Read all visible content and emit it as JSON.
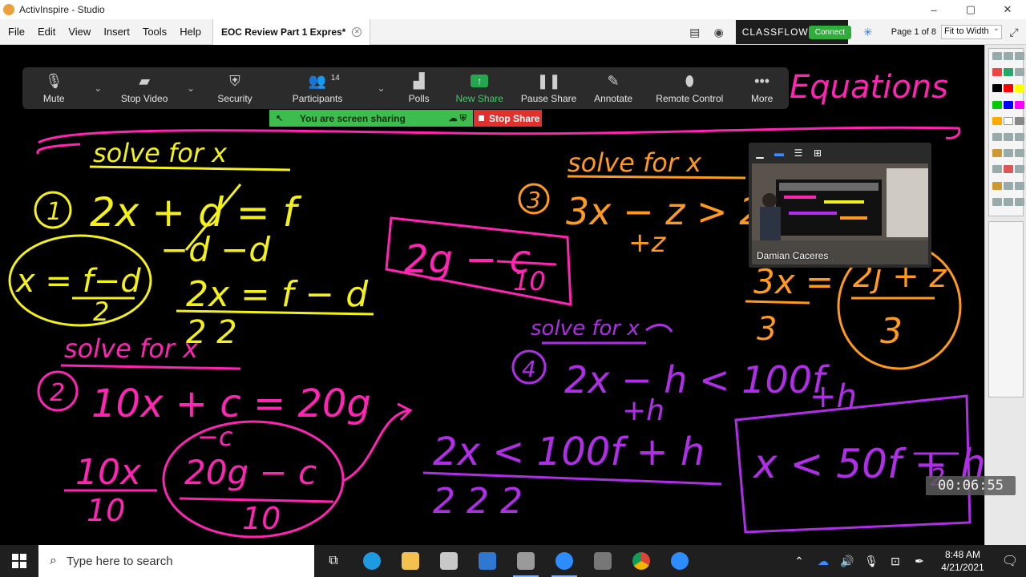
{
  "window": {
    "title": "ActivInspire - Studio",
    "controls": [
      "–",
      "▢",
      "✕"
    ]
  },
  "menubar": {
    "items": [
      "File",
      "Edit",
      "View",
      "Insert",
      "Tools",
      "Help"
    ],
    "document_tab": "EOC Review Part 1 Expres*",
    "classflow_brand": "CLASSFLOW",
    "connect_label": "Connect",
    "page_info": "Page 1 of 8",
    "zoom_select": "Fit to Width"
  },
  "zoom_toolbar": {
    "items": [
      {
        "label": "Mute",
        "icon": "microphone-icon"
      },
      {
        "label": "Stop Video",
        "icon": "video-camera-icon"
      },
      {
        "label": "Security",
        "icon": "shield-icon"
      },
      {
        "label": "Participants",
        "icon": "participants-icon",
        "count": "14"
      },
      {
        "label": "Polls",
        "icon": "polls-icon"
      },
      {
        "label": "New Share",
        "icon": "share-arrow-icon"
      },
      {
        "label": "Pause Share",
        "icon": "pause-icon"
      },
      {
        "label": "Annotate",
        "icon": "pen-icon"
      },
      {
        "label": "Remote Control",
        "icon": "mouse-icon"
      },
      {
        "label": "More",
        "icon": "more-dots-icon"
      }
    ],
    "sharing_banner": "You are screen sharing",
    "stop_share": "Stop Share"
  },
  "video_panel": {
    "participant_name": "Damian Caceres"
  },
  "timer": "00:06:55",
  "board": {
    "title_fragment": "Equations",
    "heading1": "solve for x",
    "heading2": "solve for x",
    "heading3": "solve for x",
    "heading4": "solve for x",
    "p1_number": "1",
    "p1_equation": "2x + d = f",
    "p1_sub": "−d        −d",
    "p1_divide": "2x   =  f − d",
    "p1_divisor": "2           2",
    "p1_answer_num": "x = f−d",
    "p1_answer_den": "2",
    "p2_number": "2",
    "p2_equation": "10x + c = 20g",
    "p2_sub": "−c",
    "p2_divide_left": "10x",
    "p2_divide_mid": "20g − c",
    "p2_divisor_left": "10",
    "p2_divisor_mid": "10",
    "p2_answer": "2g − c",
    "p2_answer_den": "10",
    "p3_number": "3",
    "p3_equation": "3x − z > 2",
    "p3_sub": "+z",
    "p3_divide": "3x =",
    "p3_divisor": "3",
    "p3_answer_num": "2j + z",
    "p3_answer_den": "3",
    "p4_number": "4",
    "p4_equation": "2x − h < 100f",
    "p4_add": "+h",
    "p4_add2": "+h",
    "p4_divide": "2x < 100f + h",
    "p4_divisor": "2        2        2",
    "p4_answer": "x < 50f + h",
    "p4_answer_den": "2"
  },
  "taskbar": {
    "search_placeholder": "Type here to search",
    "time": "8:48 AM",
    "date": "4/21/2021"
  },
  "colors": {
    "yellow_ink": "#f4f01a",
    "magenta_ink": "#ff24b4",
    "orange_ink": "#ff9a1e",
    "purple_ink": "#b12ee8",
    "zoom_bar": "#2b2b2b",
    "share_green": "#3dbd4d",
    "stop_red": "#e0312e"
  }
}
